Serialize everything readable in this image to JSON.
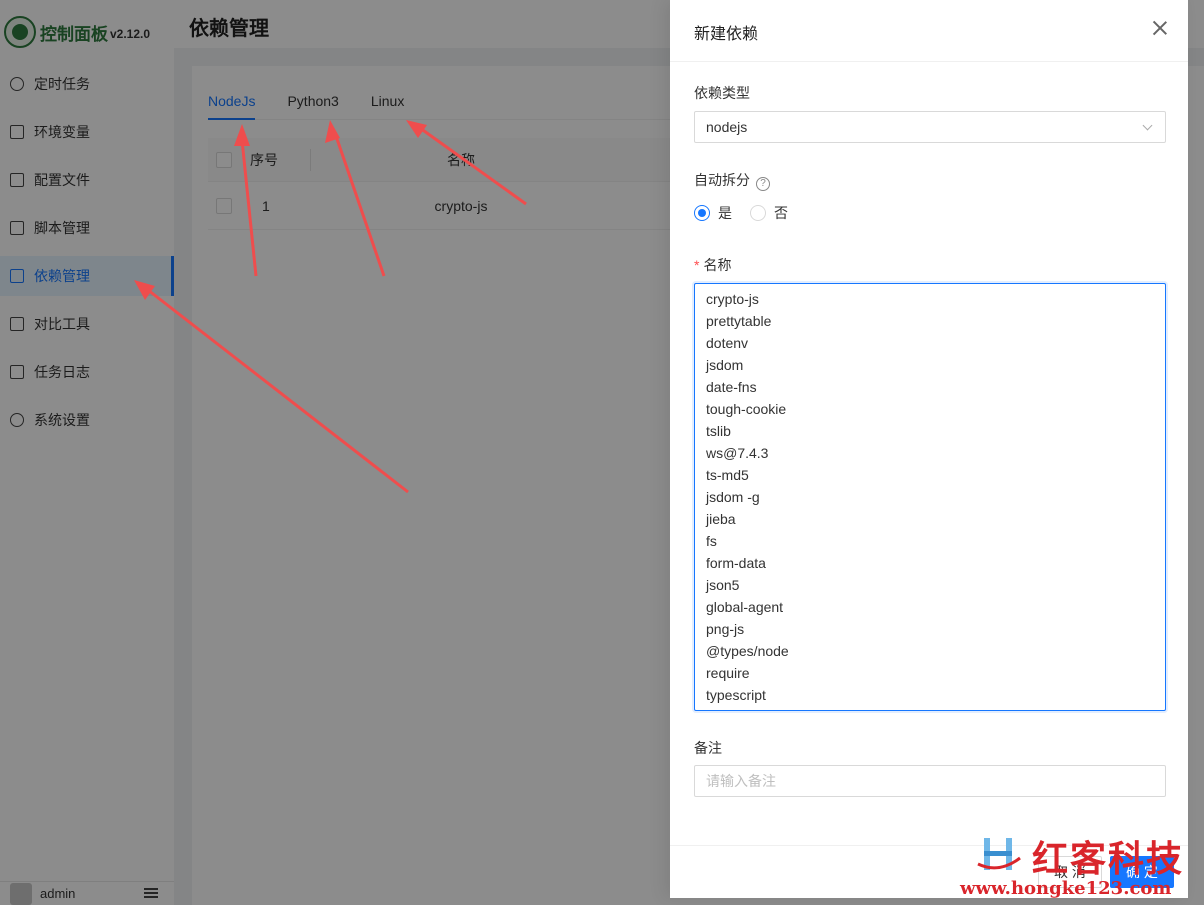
{
  "app": {
    "name": "控制面板",
    "version": "v2.12.0"
  },
  "sidebar": {
    "items": [
      {
        "label": "定时任务",
        "icon": "clock-icon"
      },
      {
        "label": "环境变量",
        "icon": "variable-icon"
      },
      {
        "label": "配置文件",
        "icon": "config-icon"
      },
      {
        "label": "脚本管理",
        "icon": "edit-icon"
      },
      {
        "label": "依赖管理",
        "icon": "package-icon",
        "active": true
      },
      {
        "label": "对比工具",
        "icon": "diff-icon"
      },
      {
        "label": "任务日志",
        "icon": "folder-icon"
      },
      {
        "label": "系统设置",
        "icon": "gear-icon"
      }
    ],
    "user": "admin"
  },
  "header": {
    "title": "依赖管理"
  },
  "tabs": [
    {
      "label": "NodeJs",
      "active": true
    },
    {
      "label": "Python3"
    },
    {
      "label": "Linux"
    }
  ],
  "table": {
    "columns": [
      "序号",
      "名称"
    ],
    "rows": [
      {
        "index": "1",
        "name": "crypto-js"
      }
    ]
  },
  "drawer": {
    "title": "新建依赖",
    "type_label": "依赖类型",
    "type_value": "nodejs",
    "split_label": "自动拆分",
    "split_options": [
      "是",
      "否"
    ],
    "split_selected": "是",
    "name_label": "名称",
    "name_lines": [
      "crypto-js",
      "prettytable",
      "dotenv",
      "jsdom",
      "date-fns",
      "tough-cookie",
      "tslib",
      "ws@7.4.3",
      "ts-md5",
      "jsdom -g",
      "jieba",
      "fs",
      "form-data",
      "json5",
      "global-agent",
      "png-js",
      "@types/node",
      "require",
      "typescript"
    ],
    "remark_label": "备注",
    "remark_placeholder": "请输入备注",
    "cancel_label": "取 消",
    "ok_label": "确 定"
  },
  "watermark": {
    "brand": "红客科技",
    "url": "www.hongke123.com"
  },
  "colors": {
    "accent": "#1677ff",
    "arrow": "#ef4d4d",
    "brand": "#2f7a3e",
    "watermark": "#d9252b"
  }
}
